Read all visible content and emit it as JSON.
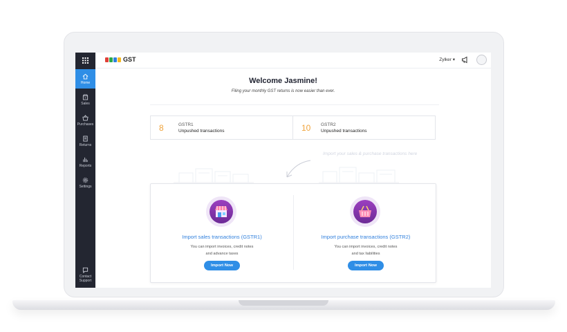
{
  "brand": {
    "product": "GST",
    "logo_letters": [
      "#e04037",
      "#2ba84a",
      "#2f7fdc",
      "#f5b921"
    ],
    "accent": "#2f8ee6",
    "sidebar_bg": "#232631",
    "highlight": "#f0a33a"
  },
  "sidebar": {
    "items": [
      {
        "label": "Home",
        "icon": "home-icon",
        "active": true
      },
      {
        "label": "Sales",
        "icon": "sales-icon",
        "active": false
      },
      {
        "label": "Purchases",
        "icon": "purchases-icon",
        "active": false
      },
      {
        "label": "Returns",
        "icon": "returns-icon",
        "active": false
      },
      {
        "label": "Reports",
        "icon": "reports-icon",
        "active": false
      },
      {
        "label": "Settings",
        "icon": "settings-icon",
        "active": false
      }
    ],
    "support_label": "Contact\nSupport"
  },
  "header": {
    "org_name": "Zylker",
    "org_caret": "▾"
  },
  "main": {
    "welcome": "Welcome Jasmine!",
    "subtitle": "Filing your monthly GST returns is now easier than ever.",
    "stats": [
      {
        "count": "8",
        "return_name": "GSTR1",
        "desc": "Unpushed transactions"
      },
      {
        "count": "10",
        "return_name": "GSTR2",
        "desc": "Unpushed transactions"
      }
    ],
    "hint": "Import your sales & purchase transactions here",
    "import": [
      {
        "title": "Import sales transactions (GSTR1)",
        "desc_line1": "You can import invoices, credit notes",
        "desc_line2": "and advance taxes",
        "button": "Import Now",
        "icon": "store-icon"
      },
      {
        "title": "Import purchase transactions (GSTR2)",
        "desc_line1": "You can import invoices, credit notes",
        "desc_line2": "and tax liabilities",
        "button": "Import Now",
        "icon": "basket-icon"
      }
    ]
  }
}
